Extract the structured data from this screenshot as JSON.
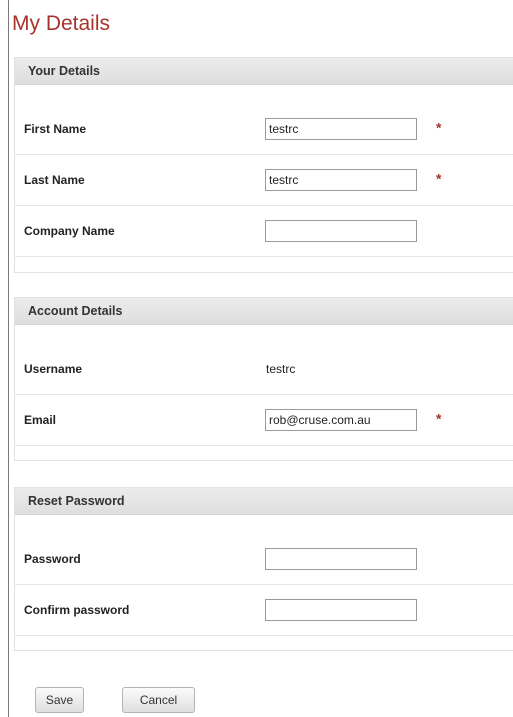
{
  "page": {
    "title": "My Details"
  },
  "your_details": {
    "heading": "Your Details",
    "first_name": {
      "label": "First Name",
      "value": "testrc",
      "required": "*"
    },
    "last_name": {
      "label": "Last Name",
      "value": "testrc",
      "required": "*"
    },
    "company_name": {
      "label": "Company Name",
      "value": ""
    }
  },
  "account_details": {
    "heading": "Account Details",
    "username": {
      "label": "Username",
      "value": "testrc"
    },
    "email": {
      "label": "Email",
      "value": "rob@cruse.com.au",
      "required": "*"
    }
  },
  "reset_password": {
    "heading": "Reset Password",
    "password": {
      "label": "Password",
      "value": ""
    },
    "confirm_password": {
      "label": "Confirm password",
      "value": ""
    }
  },
  "actions": {
    "save_label": "Save",
    "cancel_label": "Cancel"
  },
  "colors": {
    "title": "#a8332c",
    "required": "#a8332c",
    "header_bg": "#e4e4e4"
  }
}
